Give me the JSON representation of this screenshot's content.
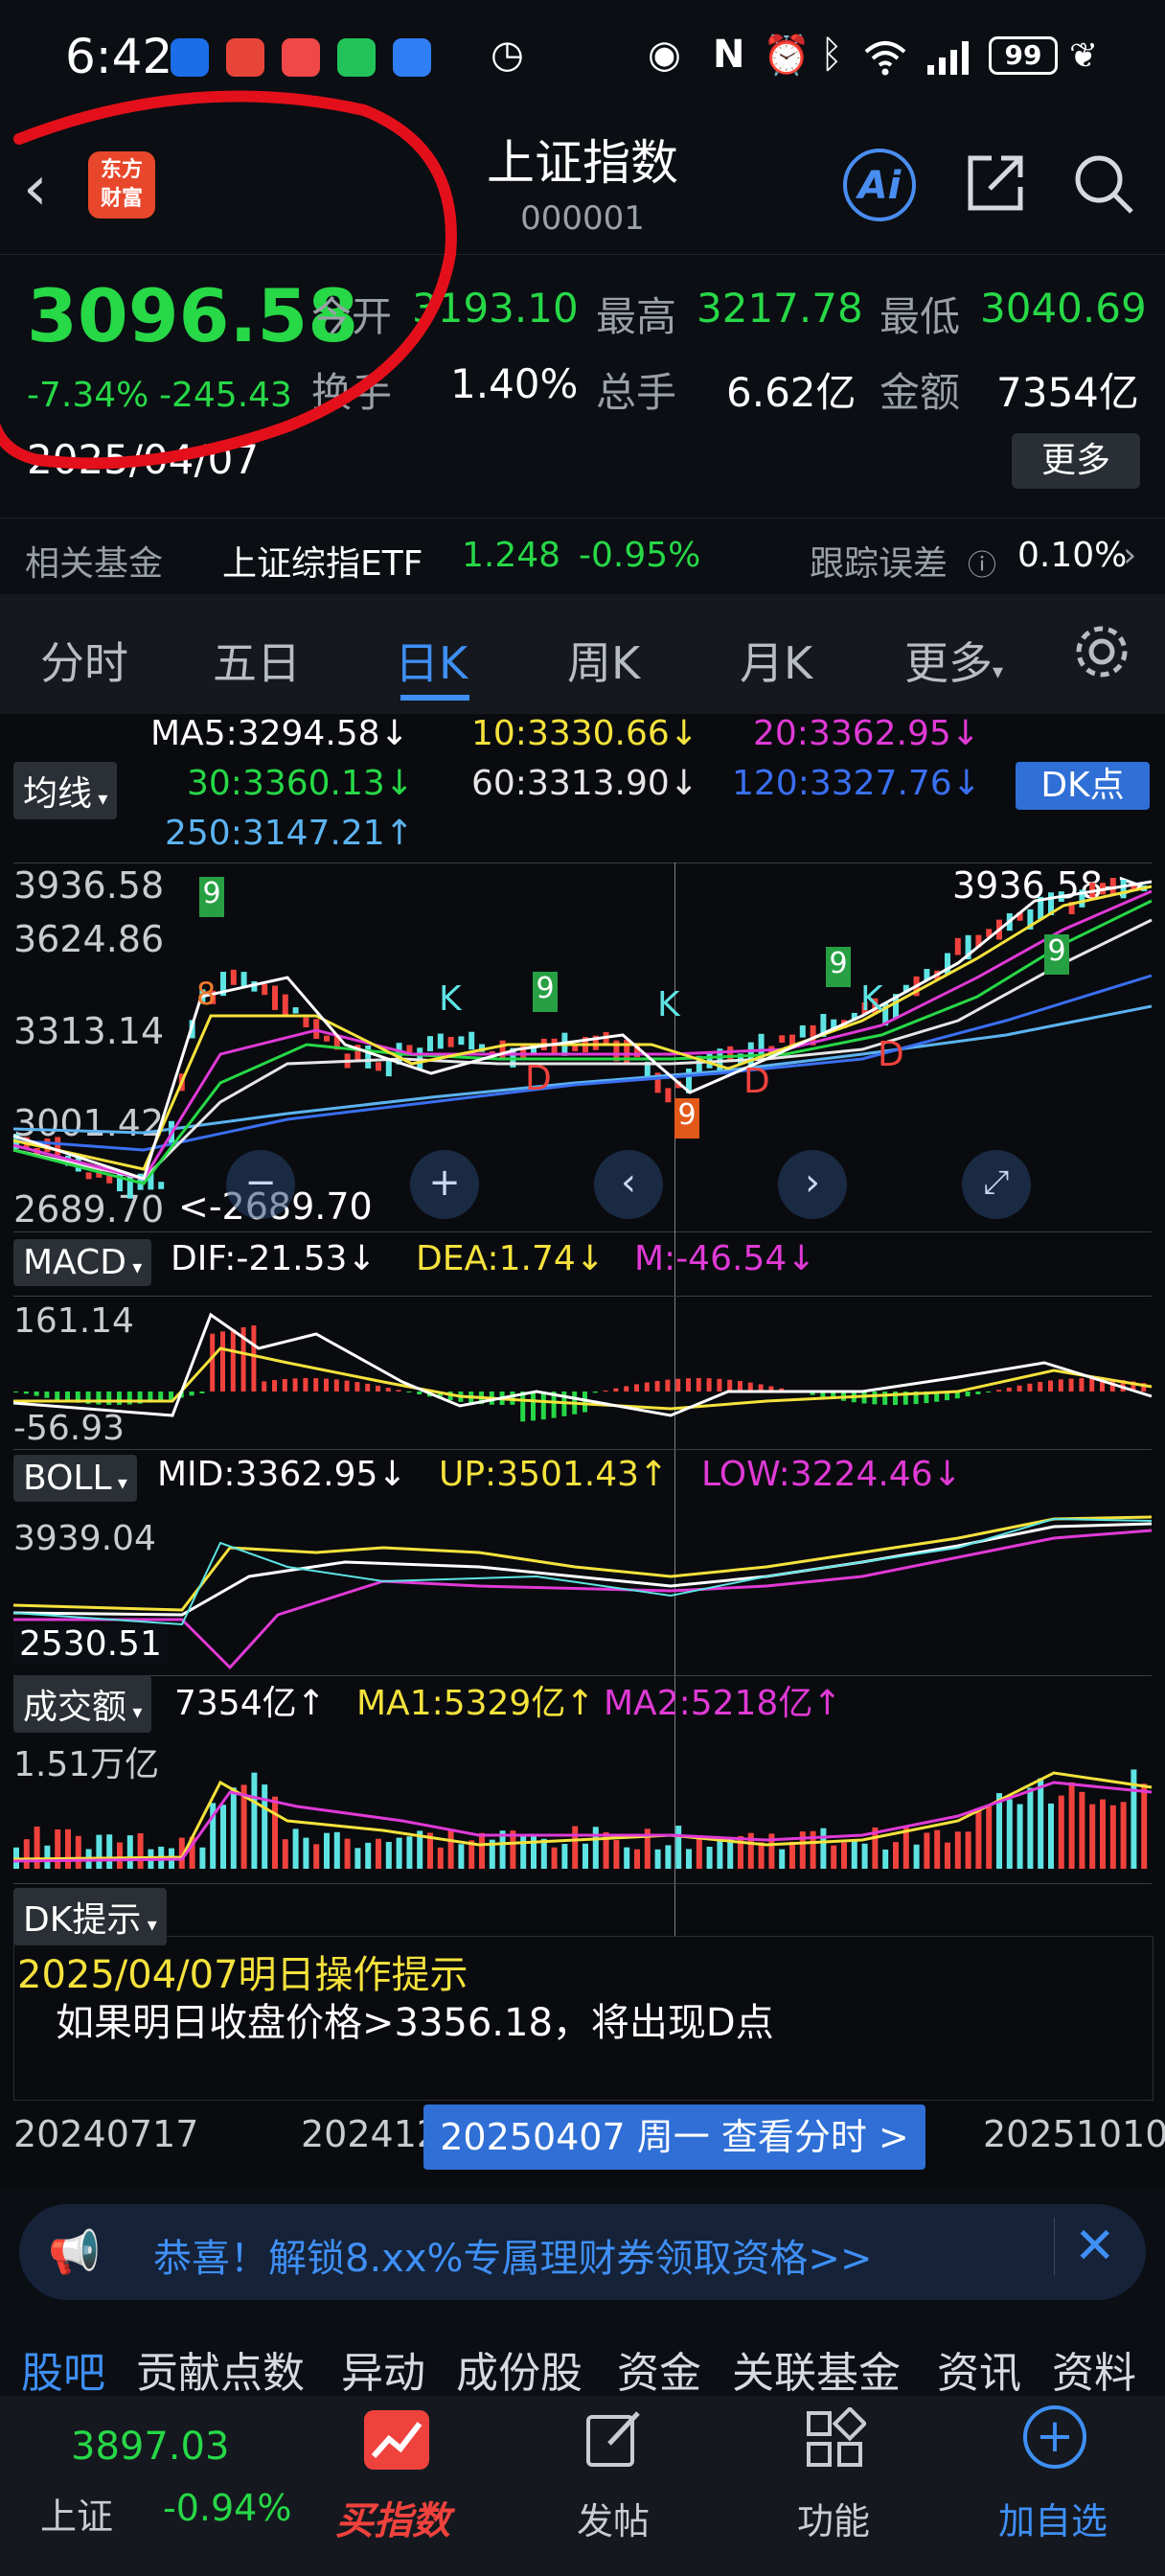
{
  "status_bar": {
    "time": "6:42",
    "battery": "99",
    "icons": [
      "app-icon-notes",
      "app-icon-huawei",
      "app-icon-red-book",
      "wechat-icon",
      "app-icon-cloud",
      "timer-icon",
      "eye-icon",
      "nfc-icon",
      "alarm-icon",
      "bluetooth-icon",
      "wifi-icon",
      "signal-icon",
      "leaf-icon"
    ]
  },
  "header": {
    "logo_text": "东方\n财富",
    "title": "上证指数",
    "code": "000001",
    "ai_label": "Ai"
  },
  "quote": {
    "price": "3096.58",
    "change_pct": "-7.34%",
    "change": "-245.43",
    "date": "2025/04/07",
    "open_label": "今开",
    "open": "3193.10",
    "high_label": "最高",
    "high": "3217.78",
    "low_label": "最低",
    "low": "3040.69",
    "turnover_label": "换手",
    "turnover": "1.40%",
    "volume_label": "总手",
    "volume": "6.62亿",
    "amount_label": "金额",
    "amount": "7354亿",
    "more_label": "更多"
  },
  "fund": {
    "label": "相关基金",
    "name": "上证综指ETF",
    "price": "1.248",
    "change": "-0.95%",
    "tracking_label": "跟踪误差",
    "tracking": "0.10%"
  },
  "tabs": [
    "分时",
    "五日",
    "日K",
    "周K",
    "月K",
    "更多"
  ],
  "active_tab": "日K",
  "ma": {
    "ma5": "MA5:3294.58↓",
    "ma10": "10:3330.66↓",
    "ma20": "20:3362.95↓",
    "ma30": "30:3360.13↓",
    "ma60": "60:3313.90↓",
    "ma120": "120:3327.76↓",
    "ma250": "250:3147.21↑",
    "dropdown": "均线",
    "dk_button": "DK点"
  },
  "kline": {
    "y_labels": [
      "3936.58",
      "3624.86",
      "3313.14",
      "3001.42",
      "2689.70"
    ],
    "max_label": "3936.58->",
    "min_label": "<-2689.70",
    "markers": [
      "9",
      "8",
      "K",
      "D",
      "9",
      "K",
      "D",
      "9",
      "9",
      "K",
      "D",
      "9"
    ]
  },
  "macd": {
    "dropdown": "MACD",
    "dif": "DIF:-21.53↓",
    "dea": "DEA:1.74↓",
    "m": "M:-46.54↓",
    "y_top": "161.14",
    "y_bottom": "-56.93"
  },
  "boll": {
    "dropdown": "BOLL",
    "mid": "MID:3362.95↓",
    "up": "UP:3501.43↑",
    "low": "LOW:3224.46↓",
    "y_top": "3939.04",
    "y_bottom": "2530.51"
  },
  "volume_panel": {
    "dropdown": "成交额",
    "value": "7354亿↑",
    "ma1": "MA1:5329亿↑",
    "ma2": "MA2:5218亿↑",
    "y_top": "1.51万亿"
  },
  "dk_tip": {
    "dropdown": "DK提示",
    "title": "2025/04/07明日操作提示",
    "text": "如果明日收盘价格>3356.18，将出现D点"
  },
  "dates": {
    "start": "20240717",
    "mid": "2024123",
    "bubble": "20250407 周一 查看分时 >",
    "end": "20251010"
  },
  "promo": {
    "text": "恭喜！解锁8.xx%专属理财券领取资格>>"
  },
  "sub_tabs": [
    "股吧",
    "贡献点数",
    "异动",
    "成份股",
    "资金",
    "关联基金",
    "资讯",
    "资料"
  ],
  "bottom": {
    "index_value": "3897.03",
    "index_name": "上证",
    "index_change": "-0.94%",
    "buy_index": "买指数",
    "post": "发帖",
    "function": "功能",
    "add_watch": "加自选"
  },
  "colors": {
    "up": "#f0423d",
    "down": "#27d847",
    "accent": "#3f8ff5",
    "annotation": "#e3101b"
  }
}
